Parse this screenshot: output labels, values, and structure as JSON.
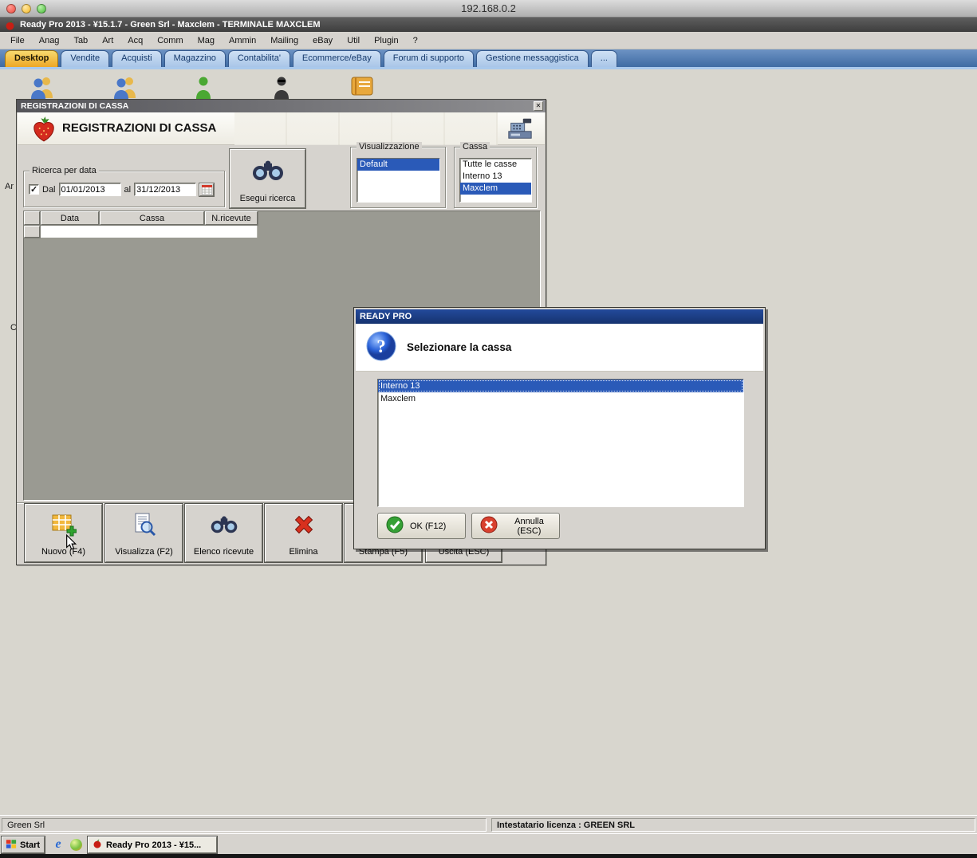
{
  "remote": {
    "title": "192.168.0.2"
  },
  "app": {
    "title": "Ready Pro 2013 - ¥15.1.7 - Green Srl - Maxclem - TERMINALE MAXCLEM",
    "menu": [
      "File",
      "Anag",
      "Tab",
      "Art",
      "Acq",
      "Comm",
      "Mag",
      "Ammin",
      "Mailing",
      "eBay",
      "Util",
      "Plugin",
      "?"
    ],
    "tabs": [
      "Desktop",
      "Vendite",
      "Acquisti",
      "Magazzino",
      "Contabilita'",
      "Ecommerce/eBay",
      "Forum di supporto",
      "Gestione messaggistica",
      "..."
    ]
  },
  "desktop": {
    "partial_labels": [
      "Ar",
      "C"
    ]
  },
  "window": {
    "title": "REGISTRAZIONI DI CASSA",
    "header_title": "REGISTRAZIONI DI CASSA",
    "search": {
      "group_label": "Ricerca per data",
      "checkbox_label": "Dal",
      "date_from": "01/01/2013",
      "between_label": "al",
      "date_to": "31/12/2013",
      "search_button": "Esegui ricerca"
    },
    "visualizzazione": {
      "group_label": "Visualizzazione",
      "items": [
        "Default"
      ],
      "selected_index": 0
    },
    "cassa": {
      "group_label": "Cassa",
      "items": [
        "Tutte le casse",
        "Interno 13",
        "Maxclem"
      ],
      "selected_index": 2
    },
    "table": {
      "columns": [
        "",
        "Data",
        "Cassa",
        "N.ricevute"
      ]
    },
    "toolbar": [
      "Nuovo (F4)",
      "Visualizza (F2)",
      "Elenco ricevute",
      "Elimina",
      "Stampa (F5)",
      "Uscita (ESC)"
    ]
  },
  "dialog": {
    "title": "READY PRO",
    "message": "Selezionare la cassa",
    "items": [
      "Interno 13",
      "Maxclem"
    ],
    "selected_index": 0,
    "ok_button": "OK (F12)",
    "cancel_button": "Annulla (ESC)"
  },
  "statusbar": {
    "company": "Green Srl",
    "license": "Intestatario licenza : GREEN SRL"
  },
  "taskbar": {
    "start_label": "Start",
    "app_button": "Ready Pro 2013 - ¥15..."
  },
  "colors": {
    "selection_blue": "#2a5ab8",
    "tab_active": "#f0b42a",
    "dialog_title_bar": "#1b3d85",
    "desktop_bg": "#d8d6ce"
  }
}
